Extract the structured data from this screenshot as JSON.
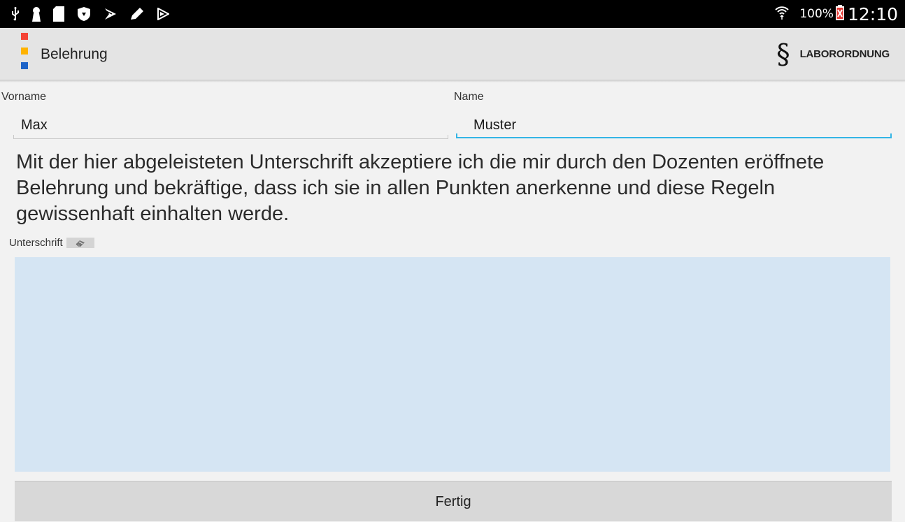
{
  "status_bar": {
    "icons": [
      "usb-icon",
      "keyhole-icon",
      "sd-card-icon",
      "shield-icon",
      "play-store-icon",
      "pen-icon",
      "play-icon"
    ],
    "battery_percent": "100%",
    "time": "12:10"
  },
  "action_bar": {
    "title": "Belehrung",
    "action_label": "LABORORDNUNG",
    "logo_colors": [
      "#f44336",
      "#ffb300",
      "#1e64c8"
    ],
    "action_icon_glyph": "§"
  },
  "form": {
    "first_name_label": "Vorname",
    "first_name_value": "Max",
    "last_name_label": "Name",
    "last_name_value": "Muster"
  },
  "statement": "Mit der hier abgeleisteten Unterschrift akzeptiere ich die mir durch den Dozenten eröffnete Belehrung und bekräftige, dass ich sie in allen Punkten anerkenne und diese Regeln gewissenhaft einhalten werde.",
  "signature": {
    "label": "Unterschrift",
    "pad_color": "#d5e5f3"
  },
  "done_button": "Fertig",
  "colors": {
    "accent": "#33b5e5"
  }
}
